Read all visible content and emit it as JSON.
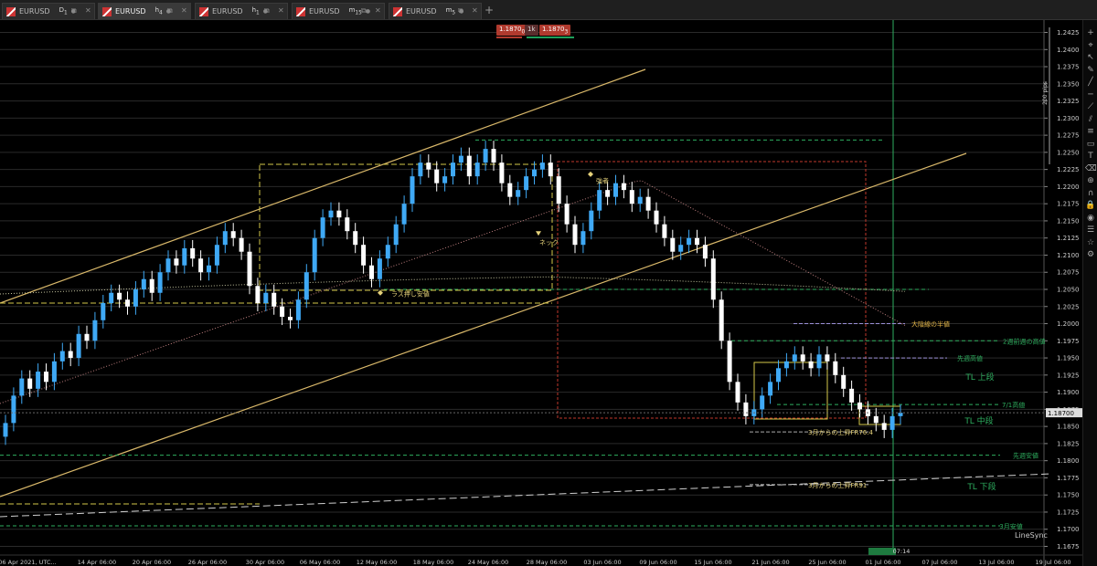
{
  "tabs": [
    {
      "symbol": "EURUSD",
      "tf": "D",
      "sub": "1",
      "active": false
    },
    {
      "symbol": "EURUSD",
      "tf": "h",
      "sub": "4",
      "active": true
    },
    {
      "symbol": "EURUSD",
      "tf": "h",
      "sub": "1",
      "active": false
    },
    {
      "symbol": "EURUSD",
      "tf": "m",
      "sub": "15",
      "active": false
    },
    {
      "symbol": "EURUSD",
      "tf": "m",
      "sub": "5",
      "active": false
    }
  ],
  "trade_panel": {
    "sell": "1.1870",
    "sell_sub": "0",
    "lot": "1k",
    "buy": "1.1870",
    "buy_sub": "3"
  },
  "chart_data": {
    "type": "candlestick",
    "symbol": "EURUSD",
    "timeframe": "H4",
    "x_tick_labels": [
      "06 Apr 2021, UTC...",
      "14 Apr 06:00",
      "20 Apr 06:00",
      "26 Apr 06:00",
      "30 Apr 06:00",
      "06 May 06:00",
      "12 May 06:00",
      "18 May 06:00",
      "24 May 06:00",
      "28 May 06:00",
      "03 Jun 06:00",
      "09 Jun 06:00",
      "15 Jun 06:00",
      "21 Jun 06:00",
      "25 Jun 06:00",
      "01 Jul 06:00",
      "07 Jul 06:00",
      "13 Jul 06:00",
      "19 Jul 06:00"
    ],
    "y_tick_labels": [
      "1.2425",
      "1.2400",
      "1.2375",
      "1.2350",
      "1.2325",
      "1.2300",
      "1.2275",
      "1.2250",
      "1.2225",
      "1.2200",
      "1.2175",
      "1.2150",
      "1.2125",
      "1.2100",
      "1.2075",
      "1.2050",
      "1.2025",
      "1.2000",
      "1.1975",
      "1.1950",
      "1.1925",
      "1.1900",
      "1.1875",
      "1.1850",
      "1.1825",
      "1.1800",
      "1.1775",
      "1.1750",
      "1.1725",
      "1.1700",
      "1.1675"
    ],
    "ylim": [
      1.1665,
      1.2435
    ],
    "current_price": "1.18700",
    "current_time_label": "07:14",
    "pips_label": "200 pips",
    "close_path": [
      1.1855,
      1.1895,
      1.192,
      1.1905,
      1.193,
      1.1915,
      1.1945,
      1.196,
      1.195,
      1.1985,
      1.1975,
      1.2005,
      1.203,
      1.2045,
      1.2035,
      1.2025,
      1.205,
      1.2065,
      1.2045,
      1.2075,
      1.2095,
      1.2085,
      1.211,
      1.2095,
      1.2075,
      1.2085,
      1.2115,
      1.2135,
      1.2125,
      1.2105,
      1.2055,
      1.203,
      1.2045,
      1.2025,
      1.201,
      1.2005,
      1.2035,
      1.2075,
      1.2125,
      1.2155,
      1.2165,
      1.2155,
      1.2135,
      1.2115,
      1.2085,
      1.2065,
      1.2095,
      1.2115,
      1.2145,
      1.2175,
      1.2215,
      1.2235,
      1.2225,
      1.2205,
      1.2215,
      1.2235,
      1.2245,
      1.2215,
      1.2235,
      1.2255,
      1.2235,
      1.2205,
      1.2185,
      1.2195,
      1.2215,
      1.2225,
      1.2235,
      1.2215,
      1.2175,
      1.2145,
      1.2115,
      1.2135,
      1.2165,
      1.2195,
      1.2185,
      1.2205,
      1.2195,
      1.2175,
      1.2185,
      1.2165,
      1.2145,
      1.2125,
      1.2105,
      1.2115,
      1.2125,
      1.2115,
      1.2095,
      1.2035,
      1.1975,
      1.1915,
      1.1885,
      1.1865,
      1.1875,
      1.1895,
      1.1915,
      1.1935,
      1.1945,
      1.1955,
      1.1945,
      1.1935,
      1.1955,
      1.1945,
      1.1925,
      1.1905,
      1.1885,
      1.1875,
      1.1865,
      1.1855,
      1.1845,
      1.1865,
      1.187
    ]
  },
  "annotations": {
    "push_low": "ラス押し安値",
    "neck": "ネック",
    "top": "強者",
    "big_level": "大陰線の半値",
    "two_weeks_high": "2週前週の高値",
    "last_week_high": "先週高値",
    "tl_upper": "TL 上段",
    "jul1_high": "7/1高値",
    "tl_middle": "TL 中段",
    "fr764": "3月からの上昇FR76.4",
    "last_week_low": "先週安値",
    "fr91": "3月からの上昇FR91",
    "tl_lower": "TL 下段",
    "march_low": "3月安値"
  },
  "linesync": "LineSync",
  "colors": {
    "bull": "#3fa9f5",
    "bear": "#ffffff",
    "trend": "#d9b86a",
    "rect_red": "#c0392b",
    "rect_yellow": "#d4c84a",
    "green": "#2eae5f",
    "lavender": "#9a8fd8"
  },
  "toolbar_icons": [
    "plus-icon",
    "crosshair-icon",
    "cursor-icon",
    "pencil-icon",
    "line-icon",
    "hline-icon",
    "trendline-icon",
    "channel-icon",
    "fib-icon",
    "rectangle-icon",
    "text-icon",
    "eraser-icon",
    "zoom-icon",
    "magnet-icon",
    "lock-icon",
    "eye-icon",
    "layer-icon",
    "star-icon",
    "settings-icon"
  ]
}
